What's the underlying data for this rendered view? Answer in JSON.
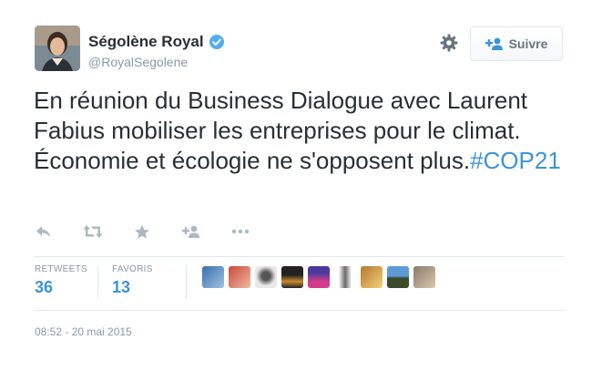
{
  "author": {
    "name": "Ségolène Royal",
    "handle": "@RoyalSegolene"
  },
  "follow_button": {
    "label": "Suivre"
  },
  "tweet": {
    "text": "En réunion du Business Dialogue avec Laurent Fabius mobiliser les entreprises pour le climat. Économie et écologie ne s'opposent plus.",
    "hashtag": "#COP21"
  },
  "stats": {
    "retweets_label": "RETWEETS",
    "retweets": "36",
    "favorites_label": "FAVORIS",
    "favorites": "13"
  },
  "timestamp": "08:52 - 20 mai 2015",
  "colors": {
    "link": "#3b94d9",
    "verified": "#55acee",
    "muted": "#8899a6",
    "text": "#292f33"
  },
  "icons": [
    "verified-icon",
    "gear-icon",
    "follow-icon",
    "reply-icon",
    "retweet-icon",
    "favorite-icon",
    "follow-action-icon",
    "more-icon"
  ]
}
